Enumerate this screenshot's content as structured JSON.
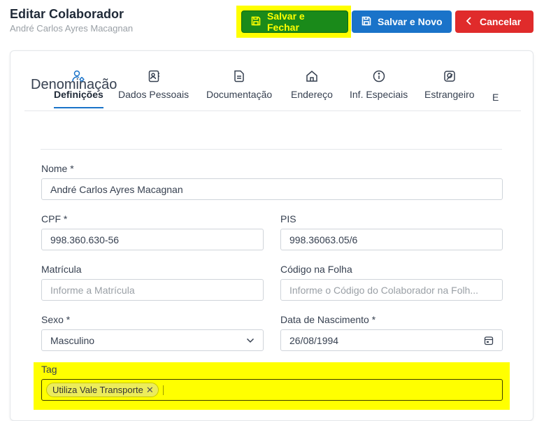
{
  "header": {
    "title": "Editar Colaborador",
    "subtitle": "André Carlos Ayres Macagnan"
  },
  "actions": {
    "save_close_label": "Salvar e Fechar",
    "save_new_label": "Salvar e Novo",
    "cancel_label": "Cancelar"
  },
  "tabs": [
    {
      "label": "Definições",
      "icon": "user-settings-icon",
      "active": true
    },
    {
      "label": "Dados Pessoais",
      "icon": "id-card-icon"
    },
    {
      "label": "Documentação",
      "icon": "document-icon"
    },
    {
      "label": "Endereço",
      "icon": "home-icon"
    },
    {
      "label": "Inf. Especiais",
      "icon": "info-icon"
    },
    {
      "label": "Estrangeiro",
      "icon": "passport-icon"
    },
    {
      "label": "E",
      "icon": ""
    }
  ],
  "section": {
    "title": "Denominação"
  },
  "form": {
    "nome": {
      "label": "Nome *",
      "value": "André Carlos Ayres Macagnan"
    },
    "cpf": {
      "label": "CPF *",
      "value": "998.360.630-56"
    },
    "pis": {
      "label": "PIS",
      "value": "998.36063.05/6"
    },
    "matricula": {
      "label": "Matrícula",
      "placeholder": "Informe a Matrícula"
    },
    "codigo_folha": {
      "label": "Código na Folha",
      "placeholder": "Informe o Código do Colaborador na Folh..."
    },
    "sexo": {
      "label": "Sexo *",
      "value": "Masculino"
    },
    "nascimento": {
      "label": "Data de Nascimento *",
      "value": "26/08/1994"
    },
    "tag": {
      "label": "Tag",
      "chips": [
        "Utiliza Vale Transporte"
      ]
    }
  },
  "colors": {
    "highlight": "#ffff00",
    "save_close_bg": "#1a8a1a",
    "save_new_bg": "#1a73c9",
    "cancel_bg": "#e02b2b",
    "active_tab_underline": "#1a73c9"
  }
}
